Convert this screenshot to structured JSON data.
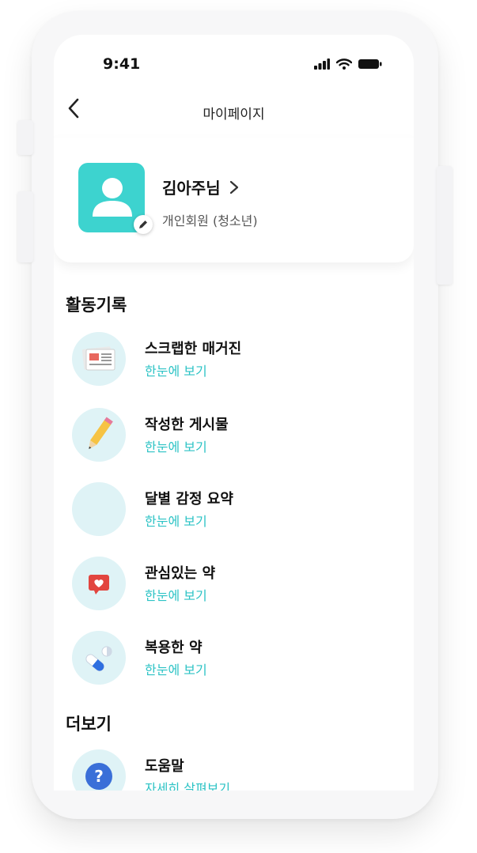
{
  "status_bar": {
    "time": "9:41"
  },
  "nav": {
    "title": "마이페이지"
  },
  "profile": {
    "name": "김아주님",
    "member_type": "개인회원 (청소년)"
  },
  "sections": {
    "activity_title": "활동기록",
    "more_title": "더보기"
  },
  "activity_items": [
    {
      "title": "스크랩한 매거진",
      "link": "한눈에 보기",
      "icon": "newspaper-icon"
    },
    {
      "title": "작성한 게시물",
      "link": "한눈에 보기",
      "icon": "pencil-icon"
    },
    {
      "title": "달별 감정 요약",
      "link": "한눈에 보기",
      "icon": "blank-icon"
    },
    {
      "title": "관심있는 약",
      "link": "한눈에 보기",
      "icon": "heart-message-icon"
    },
    {
      "title": "복용한 약",
      "link": "한눈에 보기",
      "icon": "pills-icon"
    }
  ],
  "more_items": [
    {
      "title": "도움말",
      "link": "자세히 살펴보기",
      "icon": "help-icon"
    }
  ],
  "colors": {
    "accent": "#2cc3c5",
    "avatar_bg": "#3dd3cf",
    "icon_bg": "#dff3f6"
  }
}
